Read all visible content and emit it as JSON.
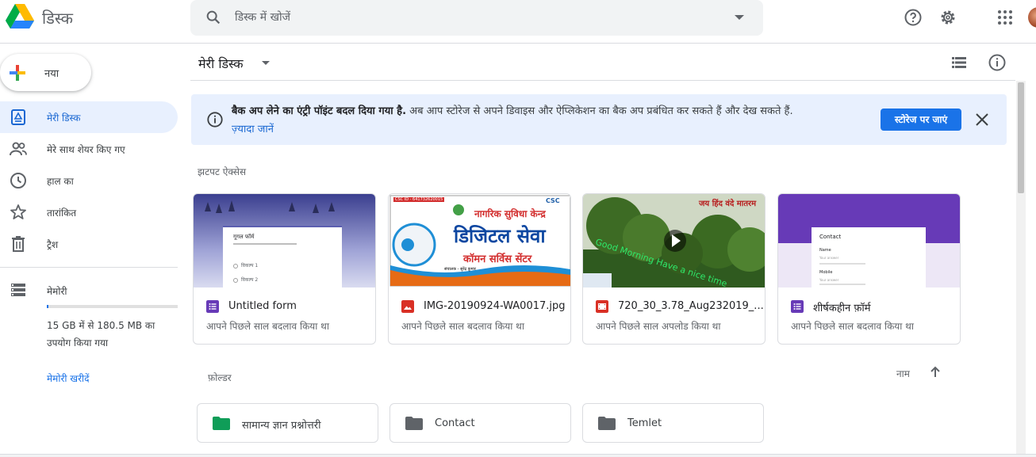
{
  "header": {
    "app_title": "डिस्क",
    "search_placeholder": "डिस्क में खोजें",
    "icons": [
      "help-icon",
      "settings-icon",
      "apps-grid-icon",
      "account-avatar"
    ]
  },
  "sidebar": {
    "new_label": "नया",
    "items": [
      {
        "label": "मेरी डिस्क",
        "icon": "my-drive-icon",
        "active": true
      },
      {
        "label": "मेरे साथ शेयर किए गए",
        "icon": "shared-people-icon",
        "active": false
      },
      {
        "label": "हाल का",
        "icon": "clock-icon",
        "active": false
      },
      {
        "label": "तारांकित",
        "icon": "star-icon",
        "active": false
      },
      {
        "label": "ट्रैश",
        "icon": "trash-icon",
        "active": false
      }
    ],
    "storage": {
      "title": "मेमोरी",
      "usage_text": "15 GB में से 180.5 MB का उपयोग किया गया",
      "usage_fraction": 0.012,
      "buy_label": "मेमोरी खरीदें"
    }
  },
  "main": {
    "title": "मेरी डिस्क",
    "banner": {
      "bold_text": "बैक अप लेने का एंट्री पॉइंट बदल दिया गया है.",
      "text": " अब आप स्टोरेज से अपने डिवाइस और ऐप्लिकेशन का बैक अप प्रबंधित कर सकते हैं और देख सकते हैं.",
      "link": "ज़्यादा जानें",
      "button": "स्टोरेज पर जाएं"
    },
    "quick_access_label": "झटपट ऐक्सेस",
    "cards": [
      {
        "name": "Untitled form",
        "meta": "आपने पिछले साल बदलाव किया था",
        "type": "form",
        "icon_color": "#673ab7"
      },
      {
        "name": "IMG-20190924-WA0017.jpg",
        "meta": "आपने पिछले साल बदलाव किया था",
        "type": "image",
        "icon_color": "#d93025"
      },
      {
        "name": "720_30_3.78_Aug232019_...",
        "meta": "आपने पिछले साल अपलोड किया था",
        "type": "video",
        "icon_color": "#d93025"
      },
      {
        "name": "शीर्षकहीन फ़ॉर्म",
        "meta": "आपने पिछले साल बदलाव किया था",
        "type": "form",
        "icon_color": "#673ab7"
      }
    ],
    "thumb_text": {
      "form1_title": "गूगल फॉर्म",
      "form1_q1": "विकल्प 1",
      "form1_q2": "विकल्प 2",
      "csc_top": "नागरिक सुविधा केन्द्र",
      "csc_id": "CSC ID - 641732620015",
      "csc_logo": "CSC",
      "csc_big": "डिजिटल सेवा",
      "csc_sub": "कॉमन सर्विस सेंटर",
      "csc_foot": "संचालक - सुरेंद्र कुमार",
      "video_title": "जय हिंद वंदे मातरम",
      "video_overlay": "Good Morning Have a nice time",
      "form2_title": "Contact",
      "form2_f1": "Name",
      "form2_f2": "Mobile",
      "form2_ph": "Your answer"
    },
    "folders_label": "फ़ोल्डर",
    "sort_label": "नाम",
    "folders": [
      {
        "name": "सामान्य ज्ञान प्रश्नोत्तरी",
        "color": "#0f9d58"
      },
      {
        "name": "Contact",
        "color": "#5f6368"
      },
      {
        "name": "Temlet",
        "color": "#5f6368"
      }
    ]
  }
}
